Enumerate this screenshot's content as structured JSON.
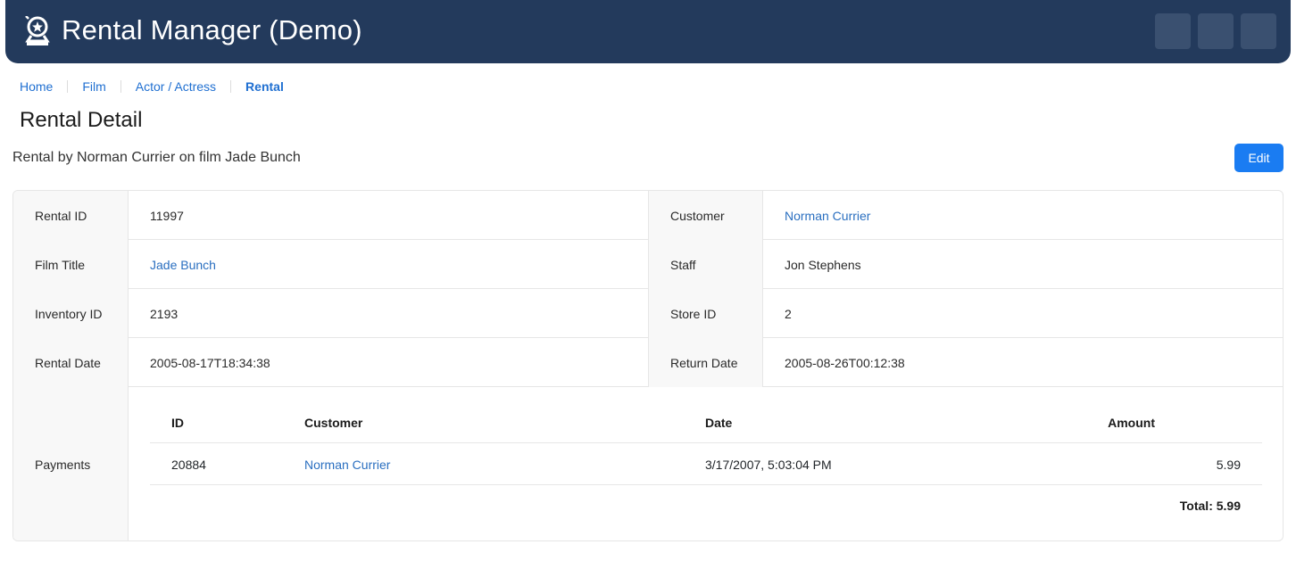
{
  "app": {
    "title": "Rental Manager (Demo)"
  },
  "breadcrumb": [
    {
      "label": "Home"
    },
    {
      "label": "Film"
    },
    {
      "label": "Actor / Actress"
    },
    {
      "label": "Rental"
    }
  ],
  "page": {
    "title": "Rental Detail",
    "subtitle": "Rental by Norman Currier on film Jade Bunch",
    "edit_label": "Edit"
  },
  "detail": {
    "rental_id": {
      "label": "Rental ID",
      "value": "11997"
    },
    "customer": {
      "label": "Customer",
      "value": "Norman Currier"
    },
    "film_title": {
      "label": "Film Title",
      "value": "Jade Bunch"
    },
    "staff": {
      "label": "Staff",
      "value": "Jon Stephens"
    },
    "inventory_id": {
      "label": "Inventory ID",
      "value": "2193"
    },
    "store_id": {
      "label": "Store ID",
      "value": "2"
    },
    "rental_date": {
      "label": "Rental Date",
      "value": "2005-08-17T18:34:38"
    },
    "return_date": {
      "label": "Return Date",
      "value": "2005-08-26T00:12:38"
    }
  },
  "payments": {
    "label": "Payments",
    "headers": {
      "id": "ID",
      "customer": "Customer",
      "date": "Date",
      "amount": "Amount"
    },
    "rows": [
      {
        "id": "20884",
        "customer": "Norman Currier",
        "date": "3/17/2007, 5:03:04 PM",
        "amount": "5.99"
      }
    ],
    "total": "Total: 5.99"
  },
  "colors": {
    "header_bg": "#233a5c",
    "accent": "#1a7cf2",
    "link": "#2a6fc0"
  }
}
